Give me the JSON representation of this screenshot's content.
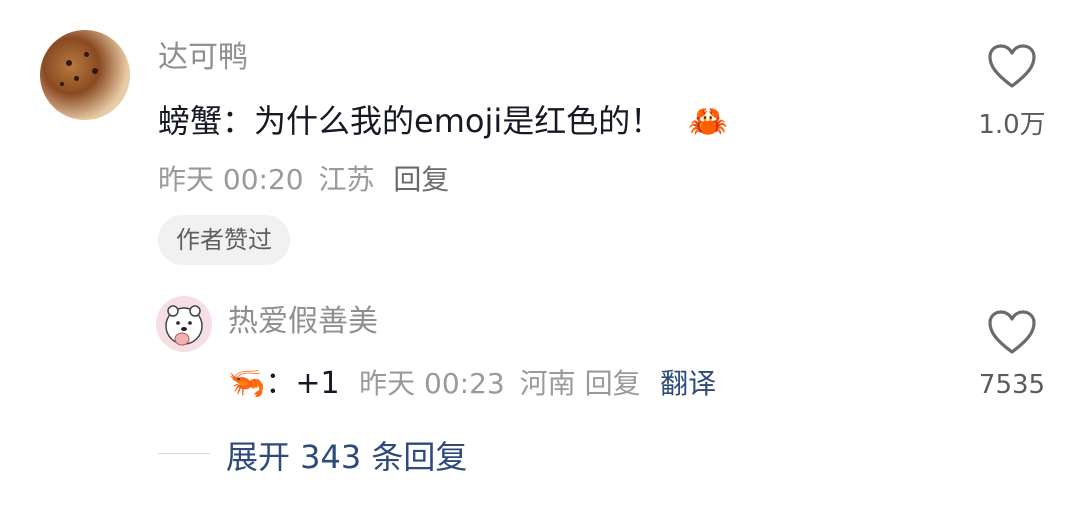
{
  "comment": {
    "author": "达可鸭",
    "text": "螃蟹：为什么我的emoji是红色的！",
    "emoji": "🦀",
    "time": "昨天 00:20",
    "location": "江苏",
    "reply_label": "回复",
    "badge": "作者赞过",
    "like_count": "1.0万",
    "heart_icon": "heart-outline-icon"
  },
  "reply": {
    "author": "热爱假善美",
    "emoji": "🦐",
    "text": "：+1",
    "time": "昨天 00:23",
    "location": "河南",
    "reply_label": "回复",
    "translate_label": "翻译",
    "like_count": "7535",
    "heart_icon": "heart-outline-icon"
  },
  "expand": {
    "label": "展开 343 条回复"
  },
  "colors": {
    "link": "#2d4a7a",
    "meta": "#9a9a9a",
    "text": "#161823"
  }
}
